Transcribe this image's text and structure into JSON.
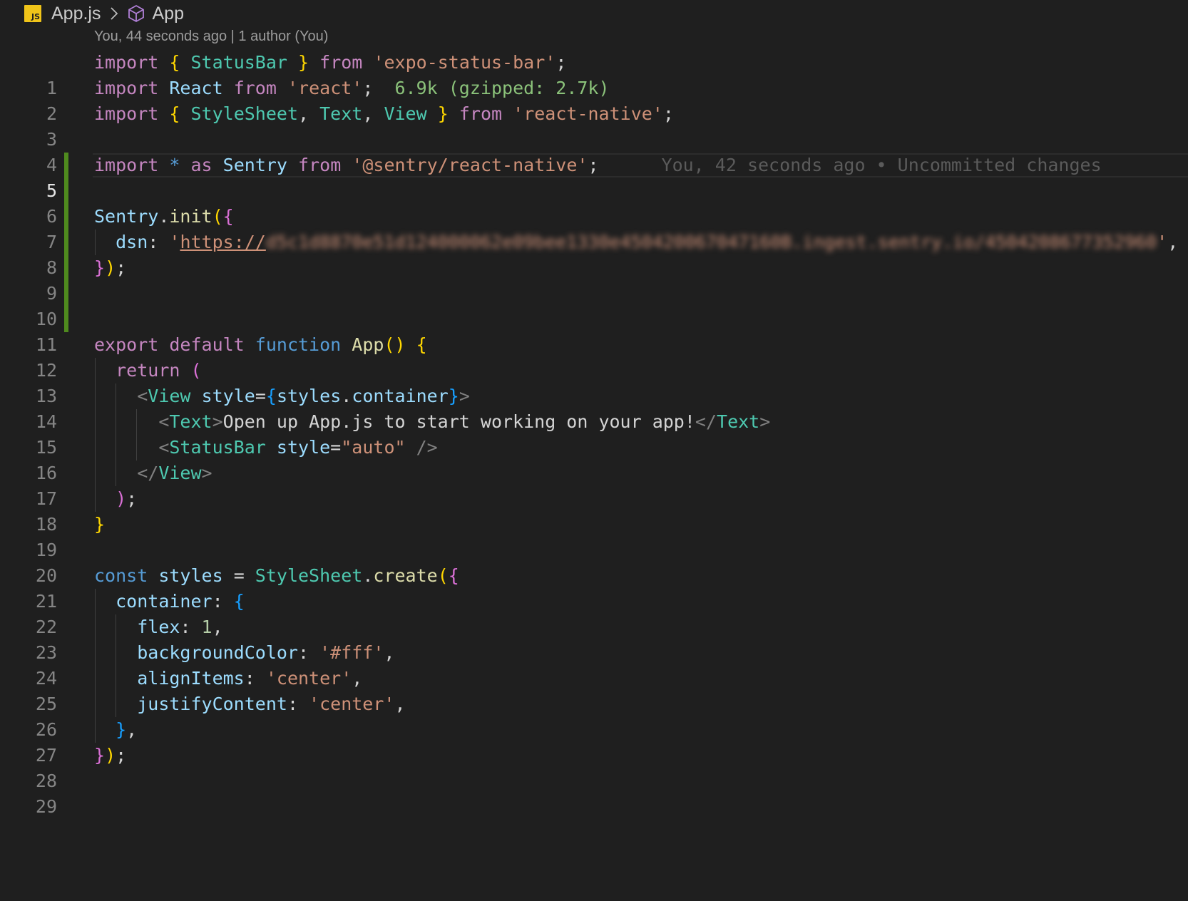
{
  "breadcrumb": {
    "file_icon_text": "JS",
    "file": "App.js",
    "symbol": "App"
  },
  "codelens": "You, 44 seconds ago | 1 author (You)",
  "blame": "You, 42 seconds ago • Uncommitted changes",
  "colors": {
    "background": "#1f1f1f",
    "modified_gutter": "#4f8a1e",
    "js_icon": "#f0c419",
    "cube_icon": "#b180d7"
  },
  "lines": [
    {
      "n": "1",
      "text": "import { StatusBar } from 'expo-status-bar';"
    },
    {
      "n": "2",
      "text": "import React from 'react';",
      "hint": "6.9k (gzipped: 2.7k)"
    },
    {
      "n": "3",
      "text": "import { StyleSheet, Text, View } from 'react-native';"
    },
    {
      "n": "4",
      "text": ""
    },
    {
      "n": "5",
      "text": "import * as Sentry from '@sentry/react-native';"
    },
    {
      "n": "6",
      "text": ""
    },
    {
      "n": "7",
      "text": "Sentry.init({"
    },
    {
      "n": "8",
      "text": "dsn: 'https://",
      "suffix": "',",
      "redacted": "d5c1d8870e51d124000062e09bee1330e450420067047160B.ingest.sentry.io/4504208677352960"
    },
    {
      "n": "9",
      "text": "});"
    },
    {
      "n": "10",
      "text": ""
    },
    {
      "n": "11",
      "text": ""
    },
    {
      "n": "12",
      "text": "export default function App() {"
    },
    {
      "n": "13",
      "text": "return ("
    },
    {
      "n": "14",
      "text": "<View style={styles.container}>"
    },
    {
      "n": "15",
      "text": "<Text>Open up App.js to start working on your app!</Text>"
    },
    {
      "n": "16",
      "text": "<StatusBar style=\"auto\" />"
    },
    {
      "n": "17",
      "text": "</View>"
    },
    {
      "n": "18",
      "text": ");"
    },
    {
      "n": "19",
      "text": "}"
    },
    {
      "n": "20",
      "text": ""
    },
    {
      "n": "21",
      "text": "const styles = StyleSheet.create({"
    },
    {
      "n": "22",
      "text": "container: {"
    },
    {
      "n": "23",
      "text": "flex: 1,"
    },
    {
      "n": "24",
      "text": "backgroundColor: '#fff',"
    },
    {
      "n": "25",
      "text": "alignItems: 'center',"
    },
    {
      "n": "26",
      "text": "justifyContent: 'center',"
    },
    {
      "n": "27",
      "text": "},"
    },
    {
      "n": "28",
      "text": "});"
    },
    {
      "n": "29",
      "text": ""
    }
  ]
}
